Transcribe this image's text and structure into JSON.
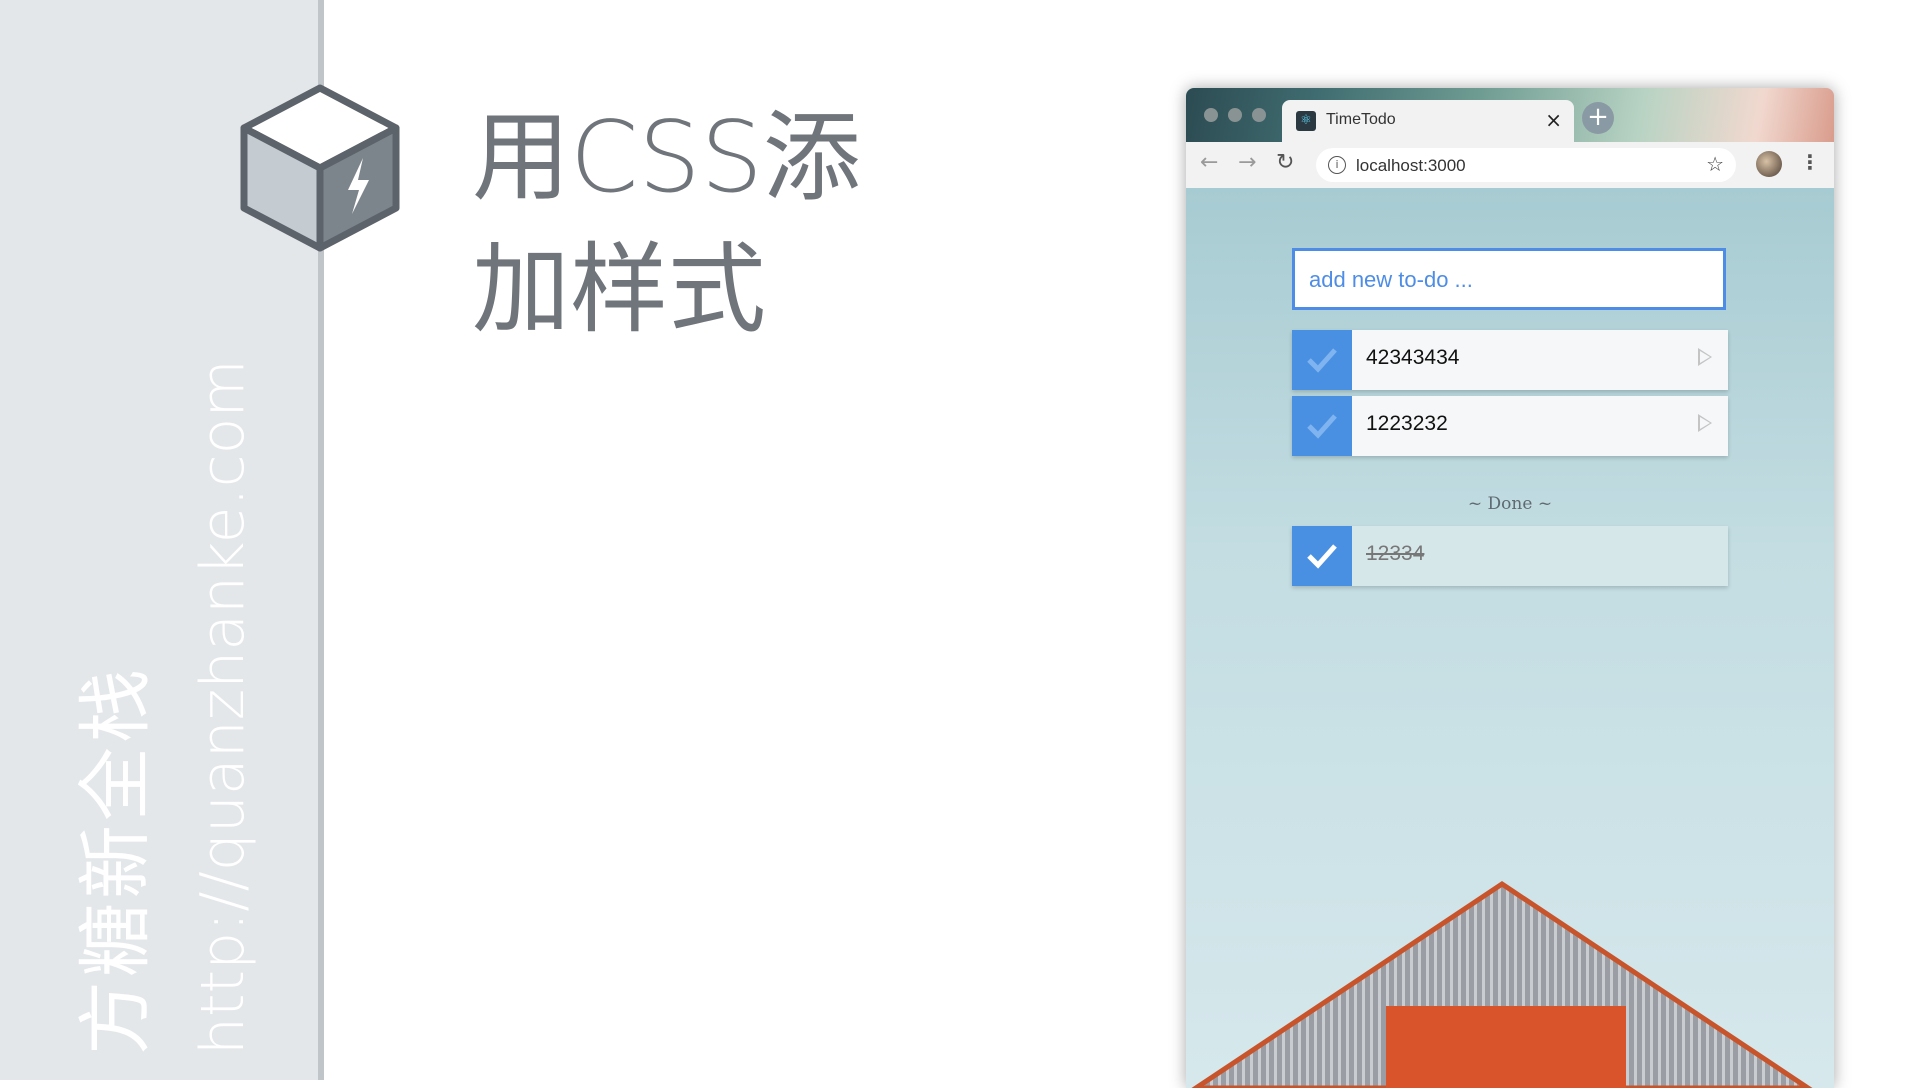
{
  "slide": {
    "title_line1": "用CSS添",
    "title_line2": "加样式"
  },
  "sidebar": {
    "brand": "方糖新全栈",
    "url": "http://quanzhanke.com"
  },
  "browser": {
    "tab_title": "TimeTodo",
    "tab_close": "×",
    "new_tab": "+",
    "url": "localhost:3000",
    "nav_back": "←",
    "nav_forward": "→",
    "nav_reload": "↻",
    "info": "i",
    "star": "☆",
    "menu": "⋮"
  },
  "app": {
    "input_placeholder": "add new to-do ...",
    "todos": [
      {
        "label": "42343434",
        "done": false
      },
      {
        "label": "1223232",
        "done": false
      }
    ],
    "done_heading": "~ Done ~",
    "done_todos": [
      {
        "label": "12334",
        "done": true
      }
    ]
  },
  "colors": {
    "accent_blue": "#4a90e2",
    "sidebar_bg": "#e4e7ea",
    "roof_orange": "#d9532b"
  }
}
